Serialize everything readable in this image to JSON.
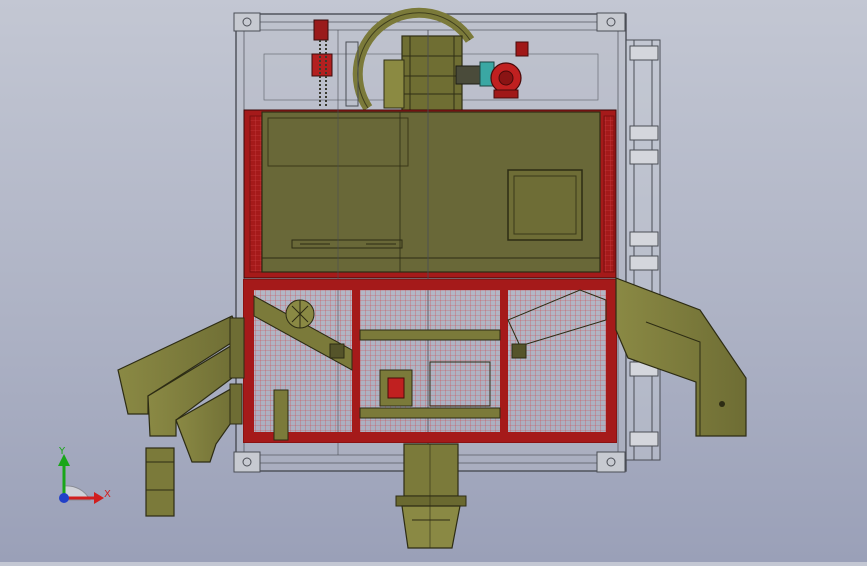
{
  "viewport": {
    "background_top": "#c3c7d3",
    "background_bottom": "#9aa0b8"
  },
  "palette": {
    "olive": "#7b7a3a",
    "olive_dark": "#55542a",
    "frame_red": "#a31919",
    "mesh_red": "#d0454a",
    "container_line": "#4a4d55",
    "motor_red": "#c02020",
    "motor_cyan": "#3aa7a3",
    "axis_x": "#d11e1e",
    "axis_y": "#19a619",
    "axis_z": "#2140c8"
  },
  "triad": {
    "x_label": "X",
    "y_label": "Y"
  }
}
